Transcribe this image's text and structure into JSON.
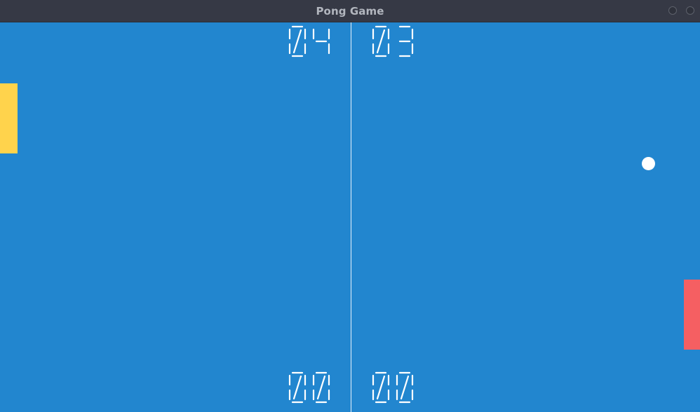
{
  "window": {
    "title": "Pong Game"
  },
  "colors": {
    "court": "#2286cf",
    "left_paddle": "#ffd34c",
    "right_paddle": "#f55f62",
    "ball": "#ffffff",
    "score_digits": "#ffffff"
  },
  "scores": {
    "top_left": "04",
    "top_right": "03",
    "bottom_left": "00",
    "bottom_right": "00"
  }
}
